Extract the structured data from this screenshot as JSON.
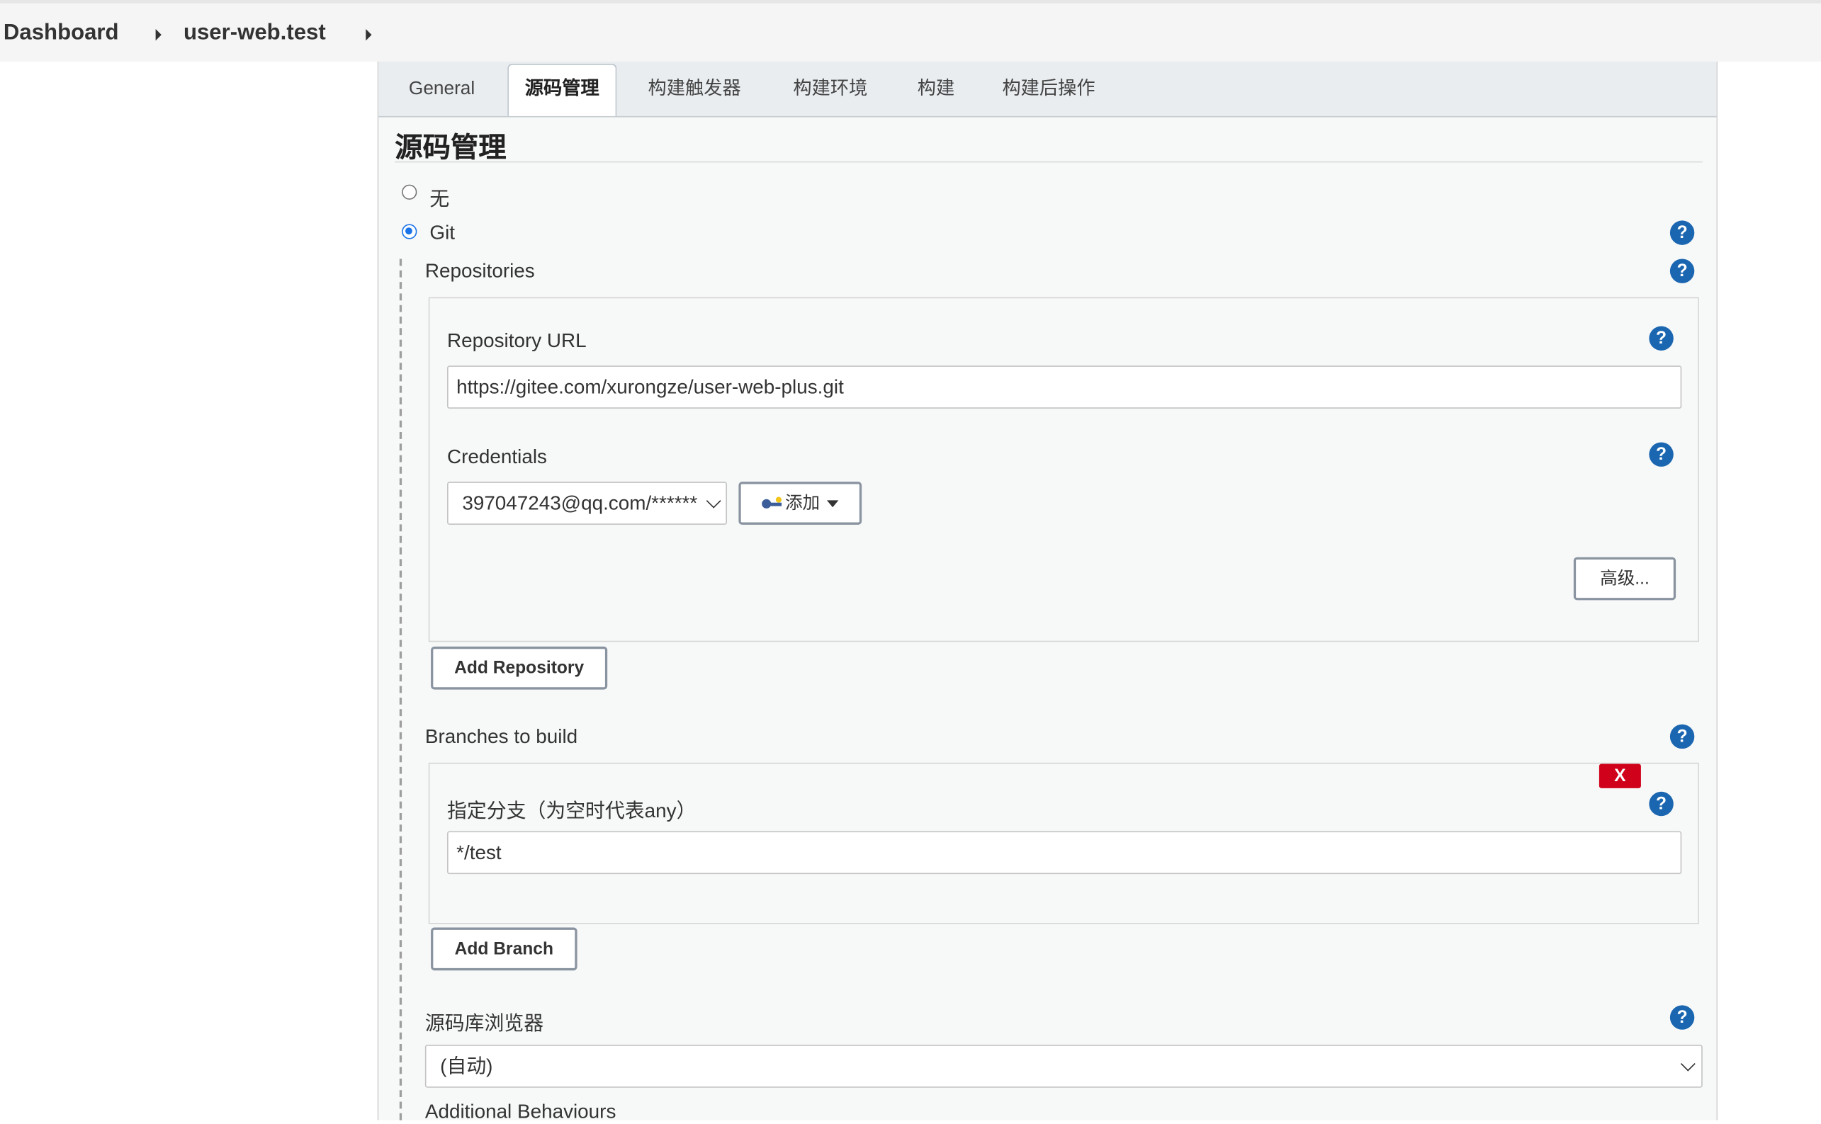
{
  "breadcrumb": {
    "items": [
      "Dashboard",
      "user-web.test"
    ]
  },
  "tabs": [
    {
      "label": "General",
      "active": false
    },
    {
      "label": "源码管理",
      "active": true
    },
    {
      "label": "构建触发器",
      "active": false
    },
    {
      "label": "构建环境",
      "active": false
    },
    {
      "label": "构建",
      "active": false
    },
    {
      "label": "构建后操作",
      "active": false
    }
  ],
  "scm": {
    "title": "源码管理",
    "options": [
      {
        "label": "无",
        "selected": false
      },
      {
        "label": "Git",
        "selected": true
      }
    ],
    "repositories": {
      "label": "Repositories",
      "url_label": "Repository URL",
      "url_value": "https://gitee.com/xurongze/user-web-plus.git",
      "credentials_label": "Credentials",
      "credentials_value": "397047243@qq.com/******",
      "add_credentials_label": "添加",
      "advanced_label": "高级...",
      "add_repository_label": "Add Repository"
    },
    "branches": {
      "label": "Branches to build",
      "delete_label": "X",
      "branch_label": "指定分支（为空时代表any）",
      "branch_value": "*/test",
      "add_branch_label": "Add Branch"
    },
    "browser": {
      "label": "源码库浏览器",
      "value": "(自动)"
    },
    "additional_label": "Additional Behaviours"
  },
  "help_icon_glyph": "?",
  "colors": {
    "help_blue": "#1a66b0",
    "radio_blue": "#1a73e8",
    "delete_red": "#d0021b",
    "panel_bg": "#f7f8f8",
    "tabbar_bg": "#e9edf0"
  }
}
